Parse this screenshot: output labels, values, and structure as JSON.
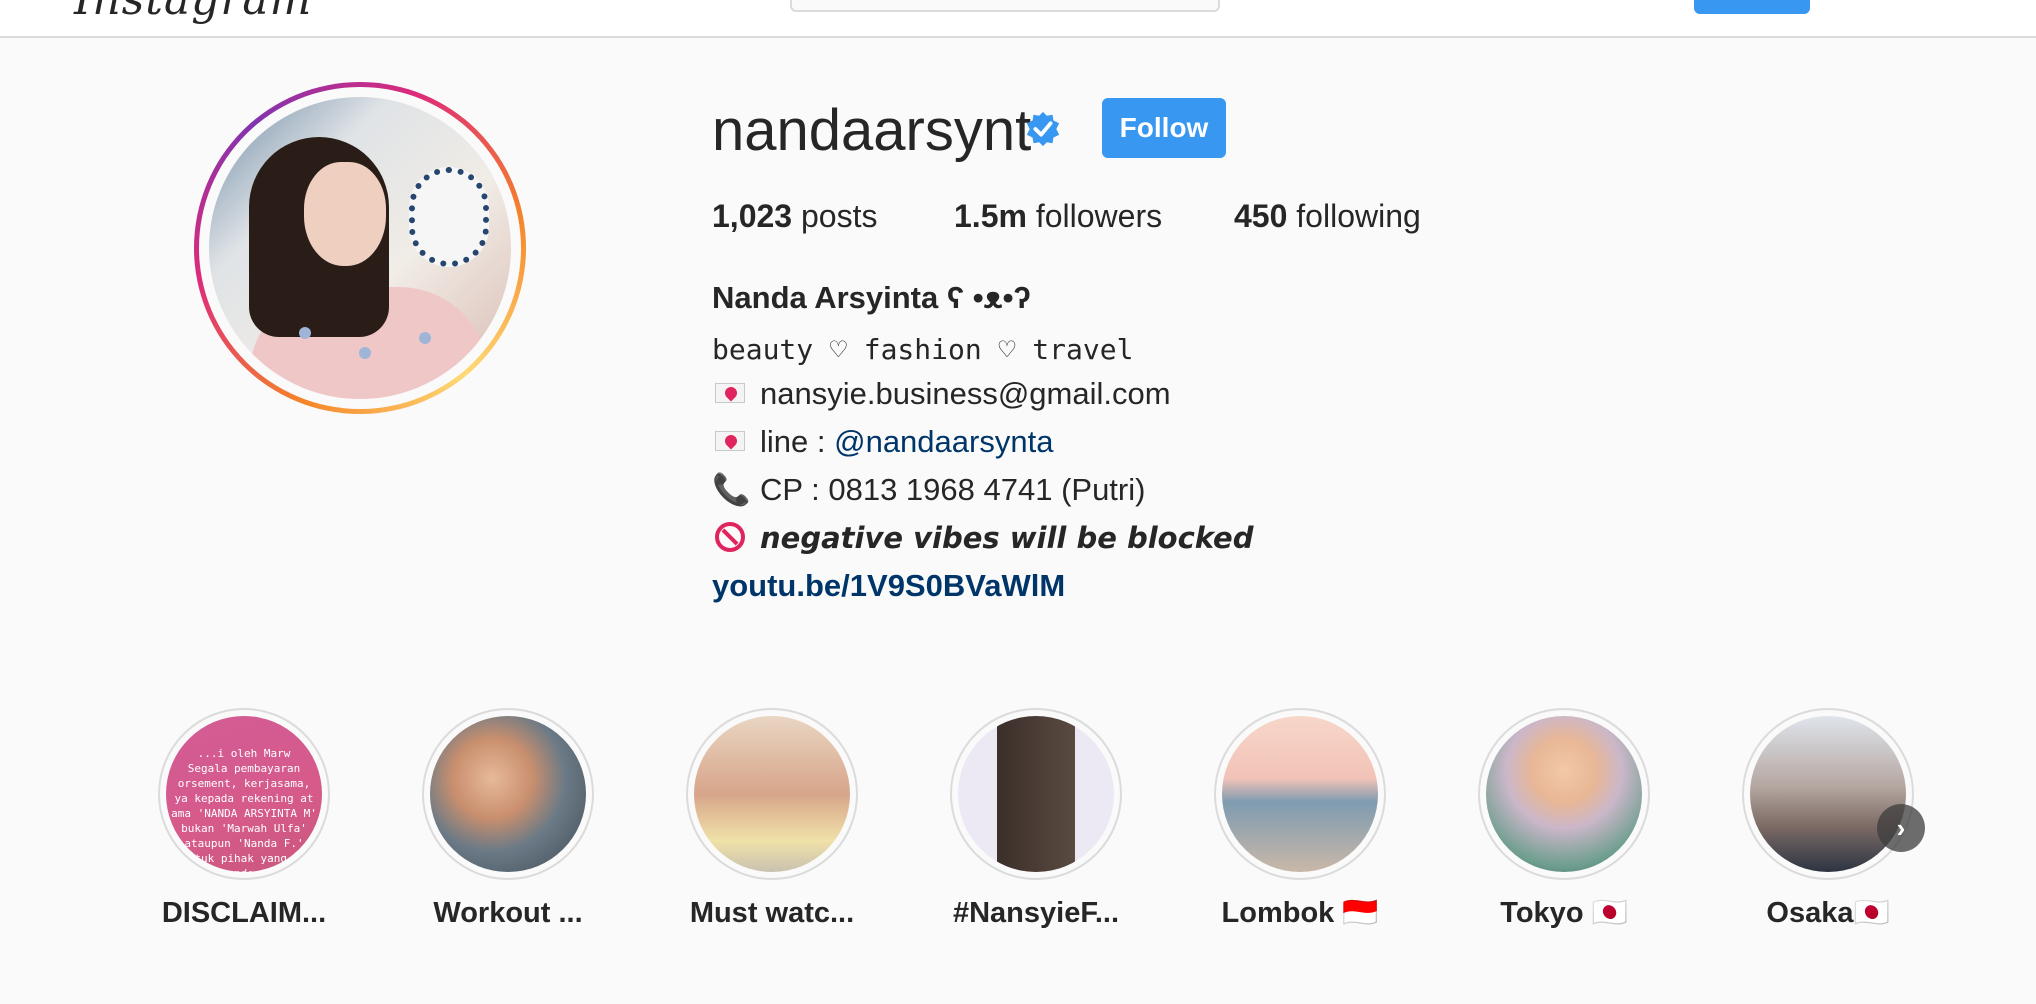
{
  "profile": {
    "username": "nandaarsynt",
    "follow_label": "Follow",
    "stats": {
      "posts_count": "1,023",
      "posts_label": " posts",
      "followers_count": "1.5m",
      "followers_label": " followers",
      "following_count": "450",
      "following_label": " following"
    },
    "bio": {
      "full_name": "Nanda Arsyinta ʕ •ᴥ•ʔ",
      "tagline": "beauty ♡ fashion ♡ travel",
      "email": "nansyie.business@gmail.com",
      "line_prefix": "line : ",
      "line_handle": "@nandaarsynta",
      "phone_icon": "📞",
      "cp": "CP : 0813 1968 4741 (Putri)",
      "negative": "negative vibes will be blocked",
      "link": "youtu.be/1V9S0BVaWlM"
    }
  },
  "highlights": [
    {
      "label": "DISCLAIM...",
      "preview_text": "...i oleh Marw\nSegala pembayaran\norsement, kerjasama,\nya kepada rekening at\nama 'NANDA ARSYINTA M'\nbukan 'Marwah Ulfa'\nataupun 'Nanda F.'\nntuk pihak yang t\nan endorsem"
    },
    {
      "label": "Workout ..."
    },
    {
      "label": "Must watc..."
    },
    {
      "label": "#NansyieF..."
    },
    {
      "label": "Lombok 🇮🇩"
    },
    {
      "label": "Tokyo 🇯🇵"
    },
    {
      "label": "Osaka🇯🇵"
    }
  ],
  "colors": {
    "accent": "#3897f0",
    "link": "#003569",
    "text": "#262626",
    "background": "#fafafa"
  },
  "icons": {
    "verified": "verified-badge-icon",
    "next": "chevron-right-icon"
  }
}
